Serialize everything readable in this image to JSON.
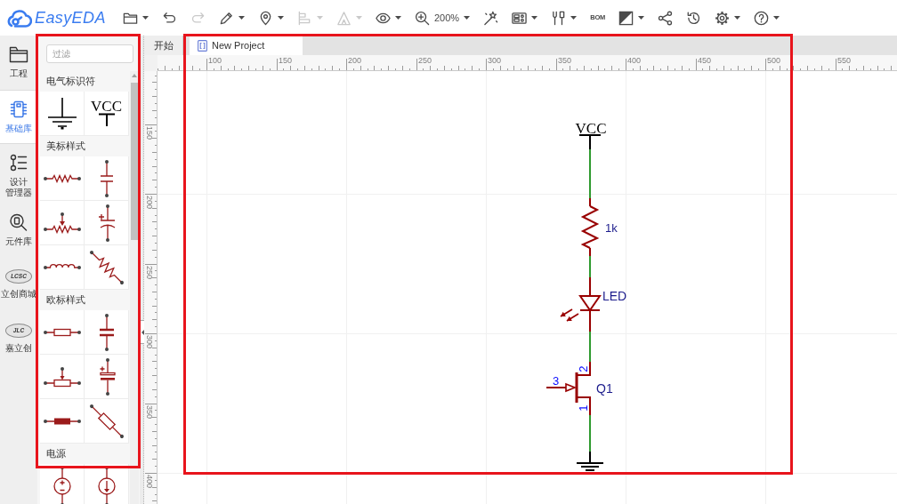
{
  "toolbar": {
    "logo": "EasyEDA",
    "items": [
      {
        "kind": "folder",
        "menu": true,
        "disabled": false
      },
      {
        "kind": "undo",
        "menu": false,
        "disabled": false
      },
      {
        "kind": "redo",
        "menu": false,
        "disabled": true
      },
      {
        "kind": "pencil",
        "menu": true,
        "disabled": false
      },
      {
        "kind": "pin",
        "menu": true,
        "disabled": false
      },
      {
        "kind": "align",
        "menu": true,
        "disabled": true
      },
      {
        "kind": "measure",
        "menu": true,
        "disabled": true
      },
      {
        "kind": "eye",
        "menu": true,
        "disabled": false
      },
      {
        "kind": "zoom",
        "menu": false,
        "disabled": false
      },
      {
        "kind": "zoom_level",
        "label": "200%",
        "menu": true,
        "disabled": false
      },
      {
        "kind": "wand",
        "menu": false,
        "disabled": false
      },
      {
        "kind": "panel",
        "menu": true,
        "disabled": false
      },
      {
        "kind": "tools",
        "menu": true,
        "disabled": false
      },
      {
        "kind": "bom",
        "label": "BOM",
        "menu": false,
        "disabled": false
      },
      {
        "kind": "contrast",
        "menu": true,
        "disabled": false
      },
      {
        "kind": "share",
        "menu": false,
        "disabled": false
      },
      {
        "kind": "history",
        "menu": false,
        "disabled": false
      },
      {
        "kind": "gear",
        "menu": true,
        "disabled": false
      },
      {
        "kind": "help",
        "menu": true,
        "disabled": false
      }
    ]
  },
  "nav": [
    {
      "kind": "project",
      "label": "工程",
      "selected": false
    },
    {
      "kind": "library",
      "label": "基础库",
      "selected": true
    },
    {
      "kind": "design_manager",
      "label": "设计管理器",
      "selected": false
    },
    {
      "kind": "parts",
      "label": "元件库",
      "selected": false
    },
    {
      "kind": "lcsc",
      "logo": "LCSC",
      "label": "立创商城",
      "selected": false
    },
    {
      "kind": "jlc",
      "logo": "JLC",
      "label": "嘉立创",
      "selected": false
    }
  ],
  "library_panel": {
    "highlighted": true,
    "filter": {
      "placeholder": "过滤"
    },
    "sections": [
      {
        "title": "电气标识符",
        "items": [
          {
            "kind": "ground"
          },
          {
            "kind": "vcc",
            "label": "VCC"
          }
        ]
      },
      {
        "title": "美标样式",
        "items": [
          {
            "kind": "us_resistor"
          },
          {
            "kind": "us_capacitor"
          },
          {
            "kind": "us_potentiometer"
          },
          {
            "kind": "us_polarized_capacitor"
          },
          {
            "kind": "inductor"
          },
          {
            "kind": "us_diagonal_resistor"
          }
        ]
      },
      {
        "title": "欧标样式",
        "items": [
          {
            "kind": "eu_resistor"
          },
          {
            "kind": "eu_capacitor"
          },
          {
            "kind": "eu_potentiometer"
          },
          {
            "kind": "eu_polarized_capacitor"
          },
          {
            "kind": "filled_resistor"
          },
          {
            "kind": "eu_diagonal_resistor"
          }
        ]
      },
      {
        "title": "电源",
        "items": [
          {
            "kind": "voltage_source"
          },
          {
            "kind": "current_source"
          }
        ]
      }
    ]
  },
  "tabs": [
    {
      "kind": "start",
      "label": "开始",
      "selected": false
    },
    {
      "kind": "schematic",
      "label": "New Project",
      "selected": true
    }
  ],
  "canvas": {
    "highlighted": true,
    "rulers": {
      "horizontal": [
        "100",
        "150",
        "200",
        "250",
        "300",
        "350",
        "400",
        "450",
        "500",
        "550"
      ],
      "vertical": [
        "150",
        "200",
        "250",
        "300",
        "350",
        "400"
      ]
    },
    "schematic": {
      "parts": [
        {
          "kind": "vcc",
          "label": "VCC"
        },
        {
          "kind": "resistor",
          "label": "1k"
        },
        {
          "kind": "led",
          "label": "LED"
        },
        {
          "kind": "transistor",
          "label": "Q1",
          "pins": [
            "3",
            "2",
            "1"
          ]
        },
        {
          "kind": "ground"
        }
      ]
    }
  }
}
